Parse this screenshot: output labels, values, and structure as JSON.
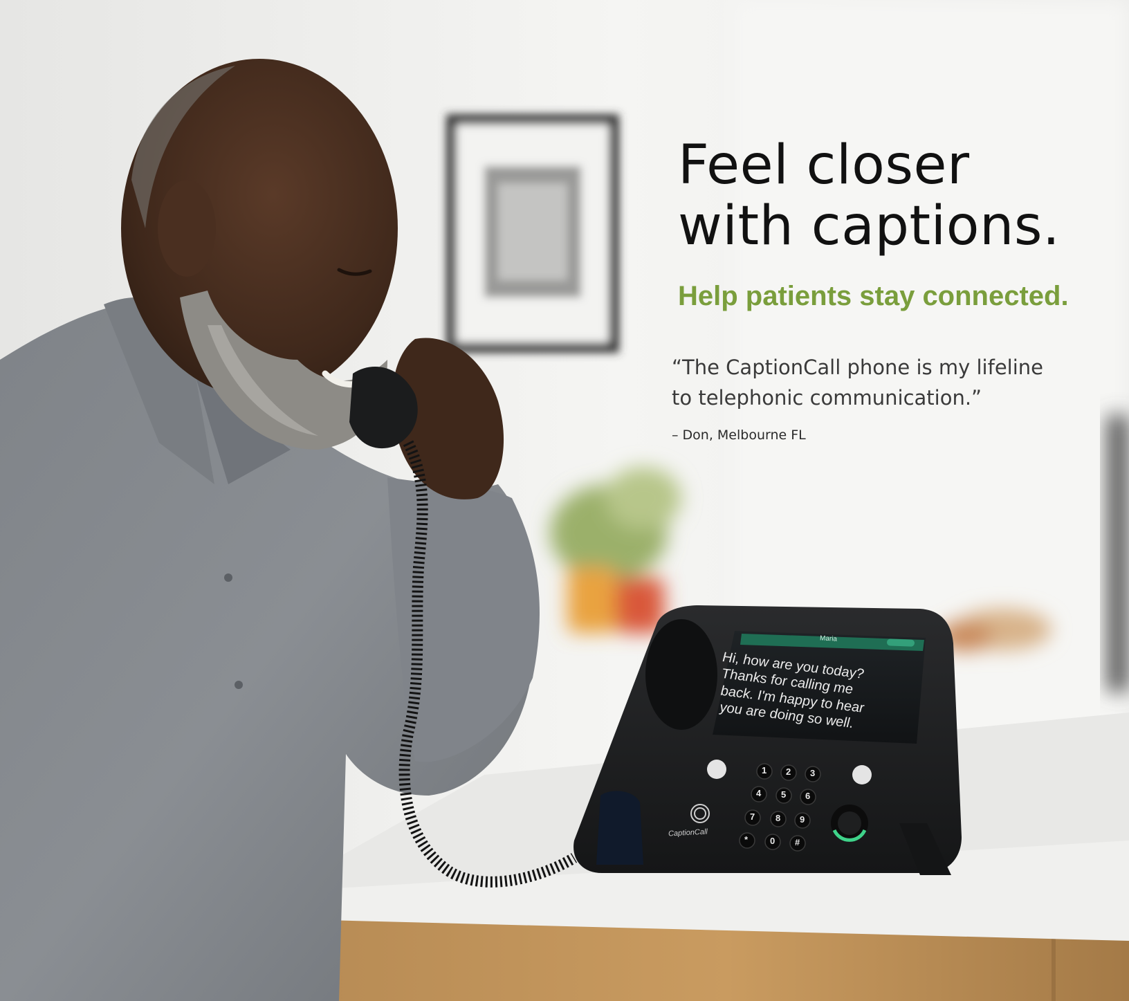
{
  "ad": {
    "headline_line1": "Feel closer",
    "headline_line2": "with captions.",
    "subheadline": "Help patients stay connected.",
    "quote_line1": "“The CaptionCall phone is my lifeline",
    "quote_line2": " to telephonic communication.”",
    "attribution": "– Don, Melbourne FL"
  },
  "phone_screen": {
    "contact_name": "Maria",
    "caption_lines": [
      "Hi, how are you today?",
      "Thanks for calling me",
      "back. I'm happy to hear",
      "you are doing so well."
    ]
  },
  "phone_device": {
    "brand": "CaptionCall",
    "keys": [
      "1",
      "2",
      "3",
      "4",
      "5",
      "6",
      "7",
      "8",
      "9",
      "*",
      "0",
      "#"
    ]
  },
  "colors": {
    "headline": "#111111",
    "accent_green": "#7a9e3c",
    "quote_text": "#3a3a3a",
    "volume_ring": "#3fd38a"
  }
}
